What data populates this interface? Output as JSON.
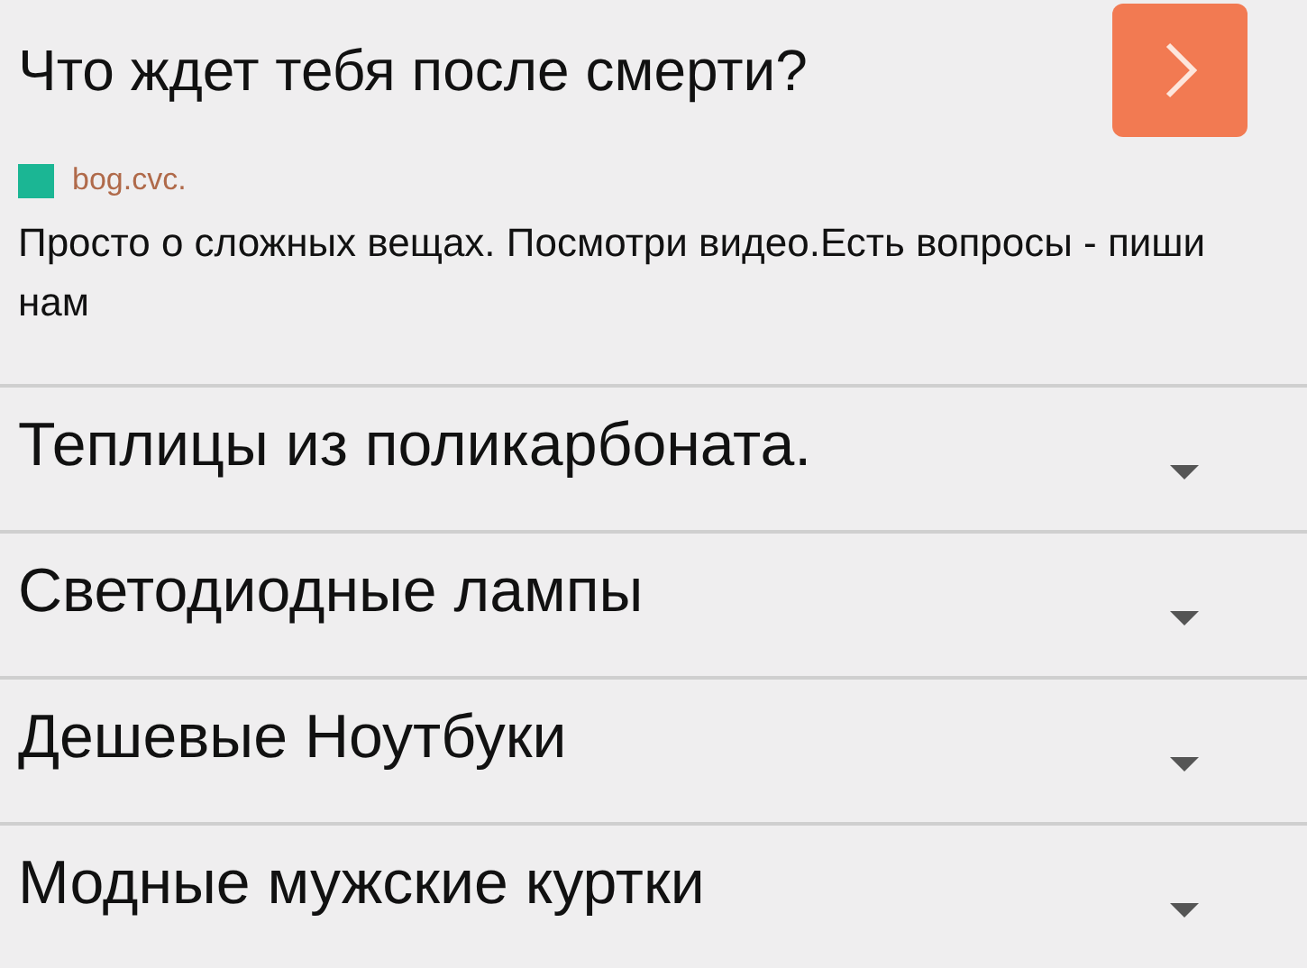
{
  "ad": {
    "title": "Что ждет тебя после смерти?",
    "domain": "bog.cvc.",
    "description": "Просто о сложных вещах. Посмотри видео.Есть вопросы - пиши нам"
  },
  "links": [
    {
      "label": "Теплицы из поликарбоната."
    },
    {
      "label": "Светодиодные лампы"
    },
    {
      "label": "Дешевые Ноутбуки"
    },
    {
      "label": "Модные мужские куртки"
    }
  ]
}
